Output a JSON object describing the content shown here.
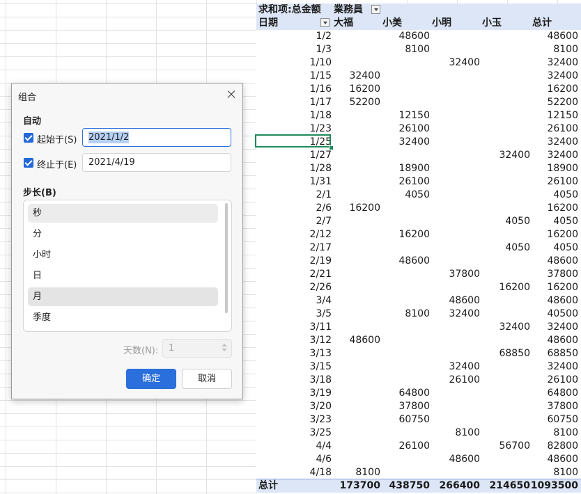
{
  "pivot": {
    "header1": {
      "field": "求和项:总金额",
      "col_field": "業務員"
    },
    "header2": {
      "row_field": "日期",
      "cols": [
        "大福",
        "小美",
        "小明",
        "小玉",
        "总计"
      ]
    },
    "rows": [
      {
        "date": "1/2",
        "v": [
          "",
          "48600",
          "",
          "",
          "48600"
        ]
      },
      {
        "date": "1/3",
        "v": [
          "",
          "8100",
          "",
          "",
          "8100"
        ]
      },
      {
        "date": "1/10",
        "v": [
          "",
          "",
          "32400",
          "",
          "32400"
        ]
      },
      {
        "date": "1/15",
        "v": [
          "32400",
          "",
          "",
          "",
          "32400"
        ]
      },
      {
        "date": "1/16",
        "v": [
          "16200",
          "",
          "",
          "",
          "16200"
        ]
      },
      {
        "date": "1/17",
        "v": [
          "52200",
          "",
          "",
          "",
          "52200"
        ]
      },
      {
        "date": "1/18",
        "v": [
          "",
          "12150",
          "",
          "",
          "12150"
        ]
      },
      {
        "date": "1/23",
        "v": [
          "",
          "26100",
          "",
          "",
          "26100"
        ]
      },
      {
        "date": "1/25",
        "v": [
          "",
          "32400",
          "",
          "",
          "32400"
        ]
      },
      {
        "date": "1/27",
        "v": [
          "",
          "",
          "",
          "32400",
          "32400"
        ]
      },
      {
        "date": "1/28",
        "v": [
          "",
          "18900",
          "",
          "",
          "18900"
        ]
      },
      {
        "date": "1/31",
        "v": [
          "",
          "26100",
          "",
          "",
          "26100"
        ]
      },
      {
        "date": "2/1",
        "v": [
          "",
          "4050",
          "",
          "",
          "4050"
        ]
      },
      {
        "date": "2/6",
        "v": [
          "16200",
          "",
          "",
          "",
          "16200"
        ]
      },
      {
        "date": "2/7",
        "v": [
          "",
          "",
          "",
          "4050",
          "4050"
        ]
      },
      {
        "date": "2/12",
        "v": [
          "",
          "16200",
          "",
          "",
          "16200"
        ]
      },
      {
        "date": "2/17",
        "v": [
          "",
          "",
          "",
          "4050",
          "4050"
        ]
      },
      {
        "date": "2/19",
        "v": [
          "",
          "48600",
          "",
          "",
          "48600"
        ]
      },
      {
        "date": "2/21",
        "v": [
          "",
          "",
          "37800",
          "",
          "37800"
        ]
      },
      {
        "date": "2/26",
        "v": [
          "",
          "",
          "",
          "16200",
          "16200"
        ]
      },
      {
        "date": "3/4",
        "v": [
          "",
          "",
          "48600",
          "",
          "48600"
        ]
      },
      {
        "date": "3/5",
        "v": [
          "",
          "8100",
          "32400",
          "",
          "40500"
        ]
      },
      {
        "date": "3/11",
        "v": [
          "",
          "",
          "",
          "32400",
          "32400"
        ]
      },
      {
        "date": "3/12",
        "v": [
          "48600",
          "",
          "",
          "",
          "48600"
        ]
      },
      {
        "date": "3/13",
        "v": [
          "",
          "",
          "",
          "68850",
          "68850"
        ]
      },
      {
        "date": "3/15",
        "v": [
          "",
          "",
          "32400",
          "",
          "32400"
        ]
      },
      {
        "date": "3/18",
        "v": [
          "",
          "",
          "26100",
          "",
          "26100"
        ]
      },
      {
        "date": "3/19",
        "v": [
          "",
          "64800",
          "",
          "",
          "64800"
        ]
      },
      {
        "date": "3/20",
        "v": [
          "",
          "37800",
          "",
          "",
          "37800"
        ]
      },
      {
        "date": "3/23",
        "v": [
          "",
          "60750",
          "",
          "",
          "60750"
        ]
      },
      {
        "date": "3/25",
        "v": [
          "",
          "",
          "8100",
          "",
          "8100"
        ]
      },
      {
        "date": "4/4",
        "v": [
          "",
          "26100",
          "",
          "56700",
          "82800"
        ]
      },
      {
        "date": "4/6",
        "v": [
          "",
          "",
          "48600",
          "",
          "48600"
        ]
      },
      {
        "date": "4/18",
        "v": [
          "8100",
          "",
          "",
          "",
          "8100"
        ]
      }
    ],
    "total": {
      "label": "总计",
      "v": [
        "173700",
        "438750",
        "266400",
        "214650",
        "1093500"
      ]
    },
    "colors": {
      "header_bg": "#dde6f6",
      "selection": "#1f8a5b"
    }
  },
  "dialog": {
    "title": "组合",
    "auto_label": "自动",
    "start": {
      "label": "起始于(S)",
      "value": "2021/1/2",
      "checked": true
    },
    "end": {
      "label": "终止于(E)",
      "value": "2021/4/19",
      "checked": true
    },
    "step_label": "步长(B)",
    "step_items": [
      "秒",
      "分",
      "小时",
      "日",
      "月",
      "季度"
    ],
    "days_label": "天数(N):",
    "days_value": "1",
    "ok_label": "确定",
    "cancel_label": "取消",
    "accent": "#2a6fdb"
  }
}
